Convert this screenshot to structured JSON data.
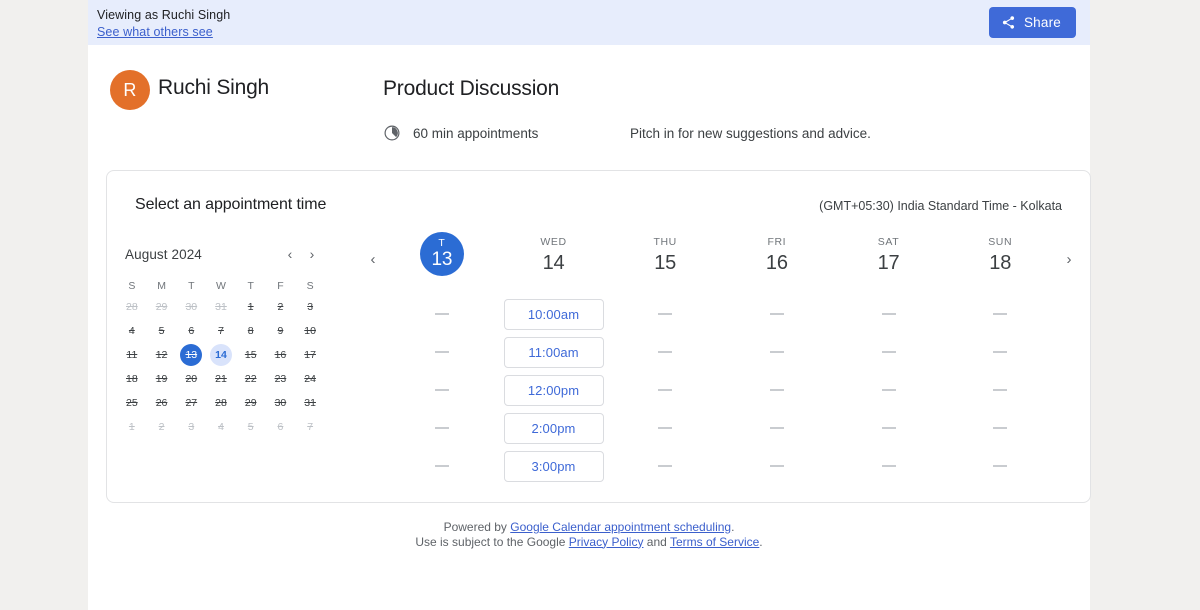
{
  "banner": {
    "viewing_as": "Viewing as Ruchi Singh",
    "see_others_link": "See what others see",
    "share_label": "Share",
    "share_icon": "share-icon",
    "share_bg": "#3f6ad8",
    "bg": "#e7edfc"
  },
  "host": {
    "avatar_initial": "R",
    "avatar_color": "#e3702a",
    "name": "Ruchi Singh"
  },
  "meeting": {
    "title": "Product Discussion",
    "duration_icon": "duration-clock-icon",
    "duration": "60 min appointments",
    "description": "Pitch in for new suggestions and advice."
  },
  "card": {
    "heading": "Select an appointment time",
    "timezone": "(GMT+05:30) India Standard Time - Kolkata"
  },
  "mini_calendar": {
    "month_label": "August 2024",
    "prev_icon": "chevron-left-icon",
    "next_icon": "chevron-right-icon",
    "dow": [
      "S",
      "M",
      "T",
      "W",
      "T",
      "F",
      "S"
    ],
    "weeks": [
      [
        {
          "n": "28",
          "state": "muted-struck"
        },
        {
          "n": "29",
          "state": "muted-struck"
        },
        {
          "n": "30",
          "state": "muted-struck"
        },
        {
          "n": "31",
          "state": "muted-struck"
        },
        {
          "n": "1",
          "state": "struck"
        },
        {
          "n": "2",
          "state": "struck"
        },
        {
          "n": "3",
          "state": "struck"
        }
      ],
      [
        {
          "n": "4",
          "state": "struck"
        },
        {
          "n": "5",
          "state": "struck"
        },
        {
          "n": "6",
          "state": "struck"
        },
        {
          "n": "7",
          "state": "struck"
        },
        {
          "n": "8",
          "state": "struck"
        },
        {
          "n": "9",
          "state": "struck"
        },
        {
          "n": "10",
          "state": "struck"
        }
      ],
      [
        {
          "n": "11",
          "state": "struck"
        },
        {
          "n": "12",
          "state": "struck"
        },
        {
          "n": "13",
          "state": "selected-struck"
        },
        {
          "n": "14",
          "state": "available"
        },
        {
          "n": "15",
          "state": "struck"
        },
        {
          "n": "16",
          "state": "struck"
        },
        {
          "n": "17",
          "state": "struck"
        }
      ],
      [
        {
          "n": "18",
          "state": "struck"
        },
        {
          "n": "19",
          "state": "struck"
        },
        {
          "n": "20",
          "state": "struck"
        },
        {
          "n": "21",
          "state": "struck"
        },
        {
          "n": "22",
          "state": "struck"
        },
        {
          "n": "23",
          "state": "struck"
        },
        {
          "n": "24",
          "state": "struck"
        }
      ],
      [
        {
          "n": "25",
          "state": "struck"
        },
        {
          "n": "26",
          "state": "struck"
        },
        {
          "n": "27",
          "state": "struck"
        },
        {
          "n": "28",
          "state": "struck"
        },
        {
          "n": "29",
          "state": "struck"
        },
        {
          "n": "30",
          "state": "struck"
        },
        {
          "n": "31",
          "state": "struck"
        }
      ],
      [
        {
          "n": "1",
          "state": "muted-struck"
        },
        {
          "n": "2",
          "state": "muted-struck"
        },
        {
          "n": "3",
          "state": "muted-struck"
        },
        {
          "n": "4",
          "state": "muted-struck"
        },
        {
          "n": "5",
          "state": "muted-struck"
        },
        {
          "n": "6",
          "state": "muted-struck"
        },
        {
          "n": "7",
          "state": "muted-struck"
        }
      ]
    ]
  },
  "day_strip": {
    "prev_icon": "chevron-left-icon",
    "next_icon": "chevron-right-icon",
    "columns": [
      {
        "dow": "T",
        "num": "13",
        "selected": true,
        "slots": [
          "-",
          "-",
          "-",
          "-",
          "-"
        ]
      },
      {
        "dow": "WED",
        "num": "14",
        "selected": false,
        "slots": [
          "10:00am",
          "11:00am",
          "12:00pm",
          "2:00pm",
          "3:00pm"
        ]
      },
      {
        "dow": "THU",
        "num": "15",
        "selected": false,
        "slots": [
          "-",
          "-",
          "-",
          "-",
          "-"
        ]
      },
      {
        "dow": "FRI",
        "num": "16",
        "selected": false,
        "slots": [
          "-",
          "-",
          "-",
          "-",
          "-"
        ]
      },
      {
        "dow": "SAT",
        "num": "17",
        "selected": false,
        "slots": [
          "-",
          "-",
          "-",
          "-",
          "-"
        ]
      },
      {
        "dow": "SUN",
        "num": "18",
        "selected": false,
        "slots": [
          "-",
          "-",
          "-",
          "-",
          "-"
        ]
      }
    ]
  },
  "footer": {
    "powered_prefix": "Powered by ",
    "powered_link": "Google Calendar appointment scheduling",
    "powered_suffix": ".",
    "terms_prefix": "Use is subject to the Google ",
    "privacy_link": "Privacy Policy",
    "terms_middle": " and ",
    "tos_link": "Terms of Service",
    "terms_suffix": "."
  }
}
